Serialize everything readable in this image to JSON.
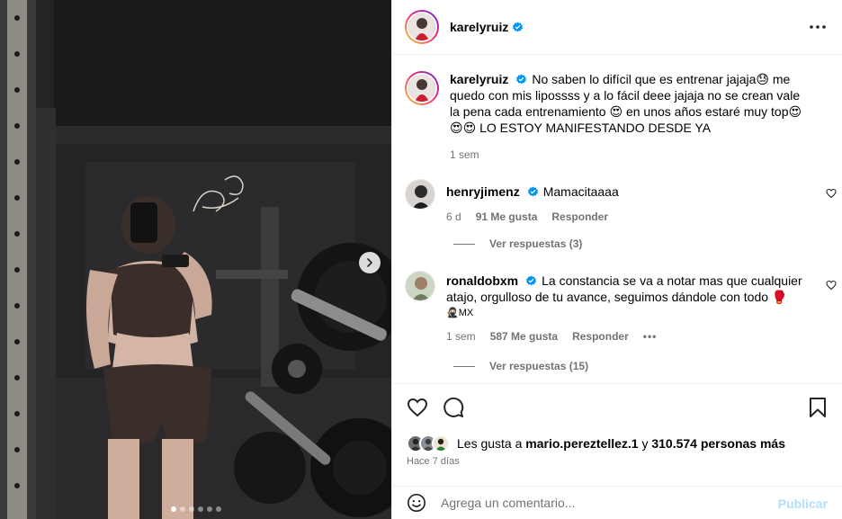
{
  "post": {
    "username": "karelyruiz",
    "verified": true
  },
  "caption": {
    "username": "karelyruiz",
    "text": "No saben lo difícil que es entrenar jajaja😓 me quedo con mis lipossss y a lo fácil deee jajaja no se crean vale la pena cada entrenamiento 😍 en unos años estaré muy top😍😍😍 LO ESTOY MANIFESTANDO DESDE YA",
    "time": "1 sem"
  },
  "comments": [
    {
      "username": "henryjimenz",
      "text": "Mamacitaaaa",
      "time": "6 d",
      "likes": "91 Me gusta",
      "reply_label": "Responder",
      "replies_label": "Ver respuestas (3)"
    },
    {
      "username": "ronaldobxm",
      "text": "La constancia se va a notar mas que cualquier atajo, orgulloso de tu avance, seguimos dándole con todo 🥊",
      "text_line2": "🥷🏻MX",
      "time": "1 sem",
      "likes": "587 Me gusta",
      "reply_label": "Responder",
      "more_label": "•••",
      "replies_label": "Ver respuestas (15)"
    }
  ],
  "likes_summary": {
    "prefix": "Les gusta a",
    "user": "mario.pereztellez.1",
    "middle": "y",
    "count": "310.574 personas más"
  },
  "posted_ago": "Hace 7 días",
  "composer": {
    "placeholder": "Agrega un comentario...",
    "publish_label": "Publicar"
  },
  "carousel": {
    "total_slides": 6,
    "active_slide": 1
  },
  "colors": {
    "verified_badge": "#0095f6",
    "publish_disabled": "#b2dffc",
    "muted_text": "#737373"
  }
}
